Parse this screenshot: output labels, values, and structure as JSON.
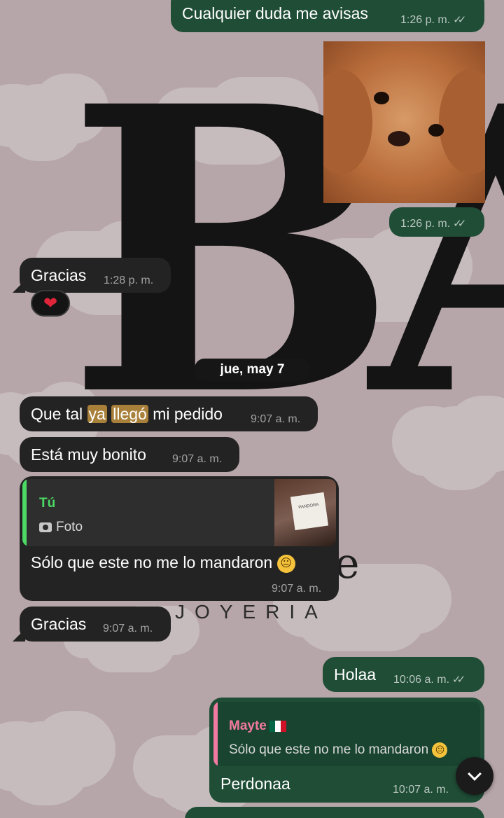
{
  "messages": {
    "m1": {
      "text": "Cualquier duda me avisas",
      "time": "1:26 p. m.",
      "tick": "✓✓"
    },
    "m2": {
      "time": "1:26 p. m.",
      "tick": "✓✓"
    },
    "m3": {
      "text": "Gracias",
      "time": "1:28 p. m.",
      "reaction": "❤"
    },
    "date_separator": "jue, may 7",
    "m4": {
      "text_before": "Que tal ",
      "hl1": "ya",
      "sp": " ",
      "hl2": "llegó",
      "text_after": " mi pedido",
      "time": "9:07 a. m."
    },
    "m5": {
      "text": "Está muy bonito",
      "time": "9:07 a. m."
    },
    "m6": {
      "quote_author": "Tú",
      "quote_label": "Foto",
      "thumb_label": "PANDORA",
      "text": "Sólo que este no me lo mandaron",
      "emoji": "😐",
      "time": "9:07 a. m."
    },
    "m7": {
      "text": "Gracias",
      "time": "9:07 a. m."
    },
    "m8": {
      "text": "Holaa",
      "time": "10:06 a. m.",
      "tick": "✓✓"
    },
    "m9": {
      "quote_author": "Mayte",
      "quote_text": "Sólo que este no me lo mandaron",
      "quote_emoji": "😐",
      "text": "Perdonaa",
      "time": "10:07 a. m."
    }
  },
  "wallpaper": {
    "logo_word": "JOYERIA",
    "logo_letters": "BA"
  },
  "colors": {
    "outgoing": "#1f4d36",
    "incoming": "#232323",
    "highlight": "#a9803a",
    "quote_you": "#4cd964",
    "quote_mayte": "#f07aa0"
  },
  "icons": {
    "scroll_down": "chevron-down-icon",
    "camera": "camera-icon"
  }
}
